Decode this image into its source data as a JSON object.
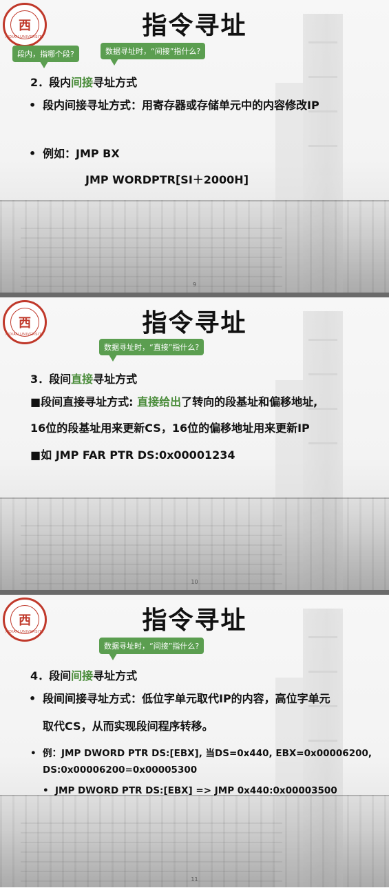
{
  "slides": [
    {
      "title": "指令寻址",
      "bubbles": [
        "段内，指哪个段?",
        "数据寻址时，“间接”指什么?"
      ],
      "heading": {
        "pre": "2．段内",
        "em": "间接",
        "post": "寻址方式"
      },
      "lines": [
        "段内间接寻址方式：用寄存器或存储单元中的内容修改IP",
        "例如：JMP BX",
        "JMP WORDPTR[SI＋2000H]"
      ],
      "page": "9"
    },
    {
      "title": "指令寻址",
      "bubbles": [
        "数据寻址时，“直接”指什么?"
      ],
      "heading": {
        "pre": "3．段间",
        "em": "直接",
        "post": "寻址方式"
      },
      "lines": [
        "■段间直接寻址方式: ",
        "直接给出",
        "了转向的段基址和偏移地址,",
        "16位的段基址用来更新CS，16位的偏移地址用来更新IP",
        "■如 JMP FAR PTR DS:0x00001234"
      ],
      "page": "10"
    },
    {
      "title": "指令寻址",
      "bubbles": [
        "数据寻址时，“间接”指什么?"
      ],
      "heading": {
        "pre": "4．段间",
        "em": "间接",
        "post": "寻址方式"
      },
      "lines": [
        "段间间接寻址方式：低位字单元取代IP的内容，高位字单元",
        "取代CS，从而实现段间程序转移。",
        "例：JMP DWORD PTR DS:[EBX], 当DS=0x440, EBX=0x00006200,",
        "DS:0x00006200=0x00005300",
        "JMP DWORD PTR DS:[EBX] => JMP 0x440:0x00003500"
      ],
      "page": "11"
    }
  ],
  "logo": {
    "text": "XIDIAN UNIVERSITY",
    "mark": "西"
  },
  "colors": {
    "accent": "#4a8c3a",
    "bubble": "#5b9e50",
    "logo": "#c0392b"
  }
}
